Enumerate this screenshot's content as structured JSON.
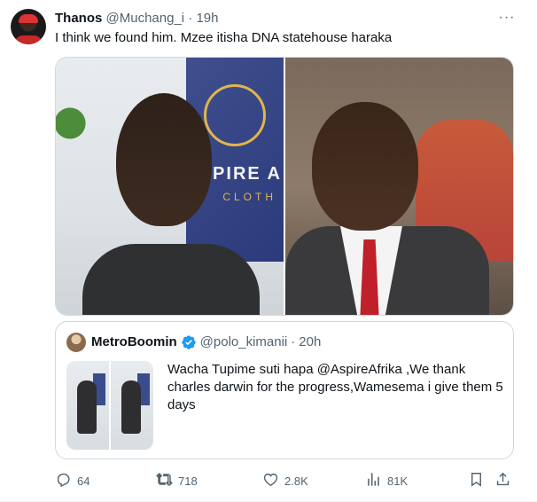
{
  "tweet": {
    "author_name": "Thanos",
    "author_handle": "@Muchang_i",
    "separator": "·",
    "time": "19h",
    "text": "I think we found him. Mzee itisha DNA statehouse haraka",
    "more_icon": "more-horizontal-icon"
  },
  "media": {
    "left_sign_text": "ASPIRE A",
    "left_sign_subtext": "CLOTH"
  },
  "quote": {
    "author_name": "MetroBoomin",
    "author_handle": "@polo_kimanii",
    "separator": "·",
    "time": "20h",
    "verified_color": "#1d9bf0",
    "text": "Wacha Tupime suti hapa @AspireAfrika ,We thank charles darwin for the progress,Wamesema i give them 5 days"
  },
  "actions": {
    "replies": "64",
    "retweets": "718",
    "likes": "2.8K",
    "views": "81K"
  },
  "colors": {
    "text_primary": "#0f1419",
    "text_secondary": "#536471",
    "border": "#cfd9de"
  }
}
